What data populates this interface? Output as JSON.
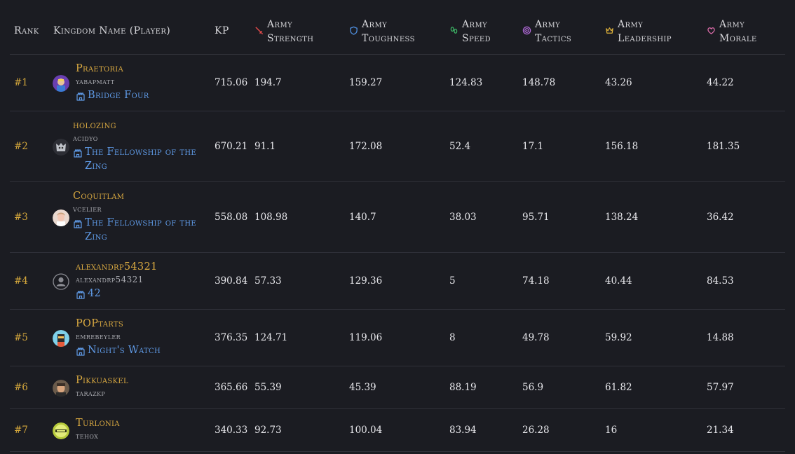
{
  "header": {
    "rank": "Rank",
    "kingdom": "Kingdom Name (Player)",
    "kp": "KP",
    "strength": [
      "Army",
      "Strength"
    ],
    "toughness": [
      "Army",
      "Toughness"
    ],
    "speed": [
      "Army",
      "Speed"
    ],
    "tactics": [
      "Army",
      "Tactics"
    ],
    "leadership": [
      "Army",
      "Leadership"
    ],
    "morale": [
      "Army",
      "Morale"
    ]
  },
  "icons": {
    "strength": "sword-icon",
    "toughness": "shield-icon",
    "speed": "footprints-icon",
    "tactics": "target-icon",
    "leadership": "crown-icon",
    "morale": "heart-icon",
    "guild": "castle-icon"
  },
  "colors": {
    "strength": "#e24a4a",
    "toughness": "#4f8fdf",
    "speed": "#3fbf6a",
    "tactics": "#b36bdc",
    "leadership": "#e0b33a",
    "morale": "#e36fae",
    "rank": "#d4a73c",
    "guild": "#5f9ae6"
  },
  "rows": [
    {
      "rank": "#1",
      "kingdom": "Praetoria",
      "player": "yabapmatt",
      "guild_lines": [
        "Bridge Four"
      ],
      "kp": "715.06",
      "strength": "194.7",
      "toughness": "159.27",
      "speed": "124.83",
      "tactics": "148.78",
      "leadership": "43.26",
      "morale": "44.22"
    },
    {
      "rank": "#2",
      "kingdom": "holozing",
      "player": "acidyo",
      "guild_lines": [
        "The Fellowship of the",
        "Zing"
      ],
      "kp": "670.21",
      "strength": "91.1",
      "toughness": "172.08",
      "speed": "52.4",
      "tactics": "17.1",
      "leadership": "156.18",
      "morale": "181.35"
    },
    {
      "rank": "#3",
      "kingdom": "Coquitlam",
      "player": "vcelier",
      "guild_lines": [
        "The Fellowship of the",
        "Zing"
      ],
      "kp": "558.08",
      "strength": "108.98",
      "toughness": "140.7",
      "speed": "38.03",
      "tactics": "95.71",
      "leadership": "138.24",
      "morale": "36.42"
    },
    {
      "rank": "#4",
      "kingdom": "alexandrp54321",
      "player": "alexandrp54321",
      "guild_lines": [
        "42"
      ],
      "kp": "390.84",
      "strength": "57.33",
      "toughness": "129.36",
      "speed": "5",
      "tactics": "74.18",
      "leadership": "40.44",
      "morale": "84.53"
    },
    {
      "rank": "#5",
      "kingdom": "POPtarts",
      "player": "emrebeyler",
      "guild_lines": [
        "Night's Watch"
      ],
      "kp": "376.35",
      "strength": "124.71",
      "toughness": "119.06",
      "speed": "8",
      "tactics": "49.78",
      "leadership": "59.92",
      "morale": "14.88"
    },
    {
      "rank": "#6",
      "kingdom": "Pikkuaskel",
      "player": "tarazkp",
      "guild_lines": [],
      "kp": "365.66",
      "strength": "55.39",
      "toughness": "45.39",
      "speed": "88.19",
      "tactics": "56.9",
      "leadership": "61.82",
      "morale": "57.97"
    },
    {
      "rank": "#7",
      "kingdom": "Turlonia",
      "player": "tehox",
      "guild_lines": [],
      "kp": "340.33",
      "strength": "92.73",
      "toughness": "100.04",
      "speed": "83.94",
      "tactics": "26.28",
      "leadership": "16",
      "morale": "21.34"
    }
  ]
}
